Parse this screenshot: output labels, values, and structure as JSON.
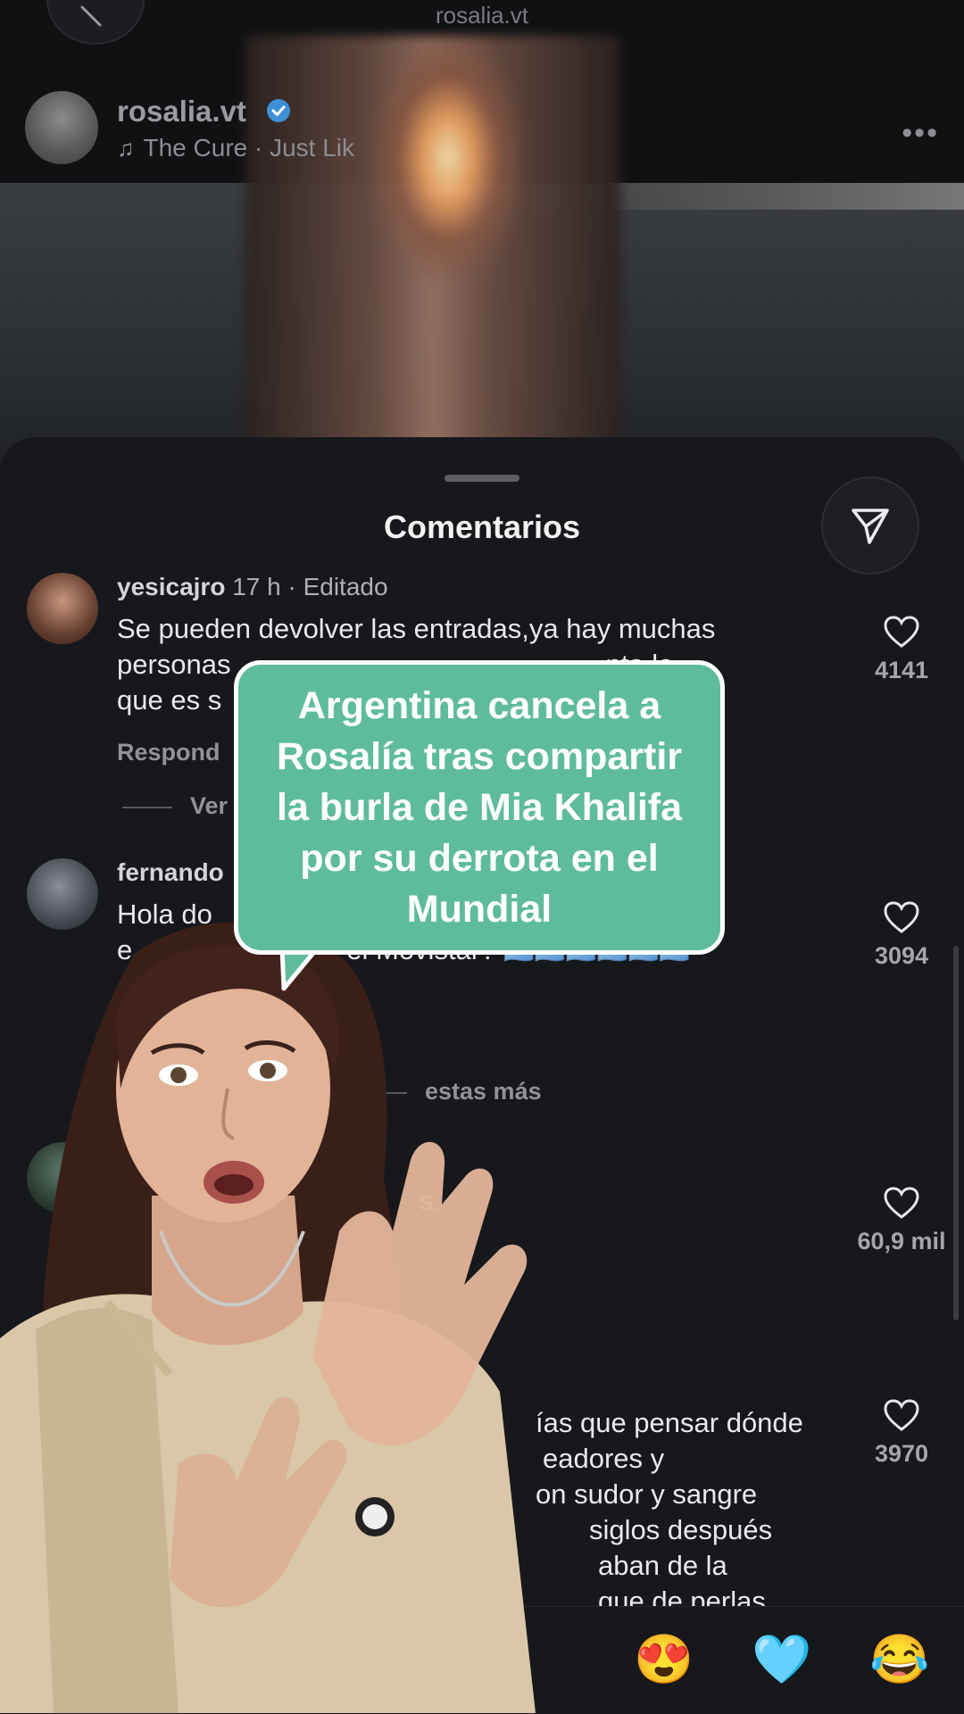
{
  "header": {
    "title": "rosalia.vt"
  },
  "post": {
    "username": "rosalia.vt",
    "music": "The Cure · Just Lik"
  },
  "comments_sheet": {
    "title": "Comentarios",
    "comments": [
      {
        "user": "yesicajro",
        "meta": " 17 h · Editado",
        "lines": [
          "Se pueden devolver las entradas,ya hay muchas",
          "personas",
          "nta lo",
          "que es s"
        ],
        "reply": "Respond",
        "view_replies": "Ver",
        "likes": "4141"
      },
      {
        "user": "fernando",
        "lines": [
          "Hola do",
          "s",
          "e",
          "el Movistar?"
        ],
        "view_replies": "estas más",
        "likes": "3094"
      },
      {
        "user": "",
        "lines": [
          "s."
        ],
        "likes": "60,9 mil"
      },
      {
        "user": "",
        "lines": [
          "ías que pensar dónde",
          "eadores y",
          "on sudor y sangre",
          "siglos después",
          "aban de la",
          "que de perlas"
        ],
        "likes": "3970"
      }
    ]
  },
  "overlay": {
    "headline": "Argentina cancela a Rosalía tras compartir la burla de Mia Khalifa por su derrota en el Mundial",
    "bubble_color": "#5ebc9a"
  },
  "reactions": [
    "😍",
    "🩵",
    "😂"
  ],
  "flags": "🇦🇷🇦🇷🇦🇷🇦🇷🇦🇷🇦🇷"
}
